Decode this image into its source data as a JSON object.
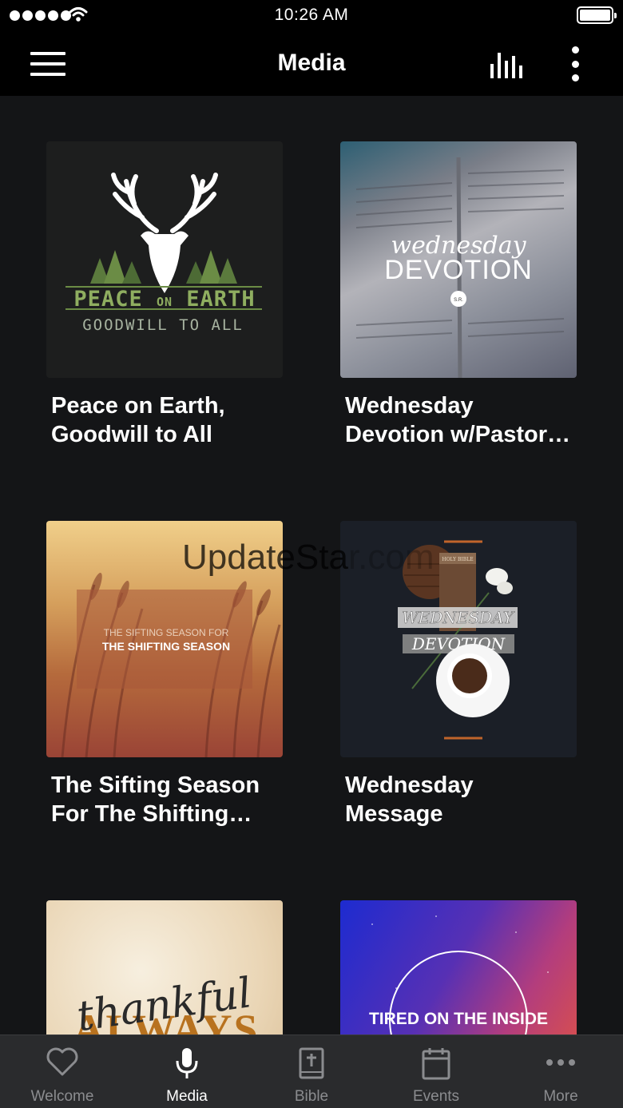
{
  "status_bar": {
    "time": "10:26 AM"
  },
  "nav": {
    "title": "Media"
  },
  "media_items": [
    {
      "title": "Peace on Earth, Goodwill to All",
      "artwork": {
        "line1_a": "PEACE",
        "line1_b": "ON",
        "line1_c": "EARTH",
        "line2": "GOODWILL TO ALL"
      }
    },
    {
      "title": "Wednesday Devotion w/Pastor…",
      "artwork": {
        "script": "wednesday",
        "main": "DEVOTION",
        "badge": "S.R."
      }
    },
    {
      "title": "The Sifting Season For The Shifting Season",
      "artwork": {
        "line1": "THE SIFTING SEASON FOR",
        "line2": "THE SHIFTING SEASON"
      }
    },
    {
      "title": "Wednesday Message",
      "artwork": {
        "line1": "WEDNESDAY",
        "line2": "DEVOTION",
        "book": "HOLY BIBLE"
      }
    },
    {
      "title": "",
      "artwork": {
        "script": "thankful",
        "main": "ALWAYS"
      }
    },
    {
      "title": "",
      "artwork": {
        "main": "TIRED ON THE INSIDE"
      }
    }
  ],
  "watermark": {
    "dark": "UpdateSta",
    "light": "r.com"
  },
  "tab_bar": [
    {
      "label": "Welcome",
      "icon": "heart-icon",
      "active": false
    },
    {
      "label": "Media",
      "icon": "microphone-icon",
      "active": true
    },
    {
      "label": "Bible",
      "icon": "bible-icon",
      "active": false
    },
    {
      "label": "Events",
      "icon": "calendar-icon",
      "active": false
    },
    {
      "label": "More",
      "icon": "more-icon",
      "active": false
    }
  ],
  "colors": {
    "background": "#141517",
    "bar": "#000000",
    "tab_bar": "#2a2b2d",
    "inactive_tab": "#8b8c8f"
  }
}
